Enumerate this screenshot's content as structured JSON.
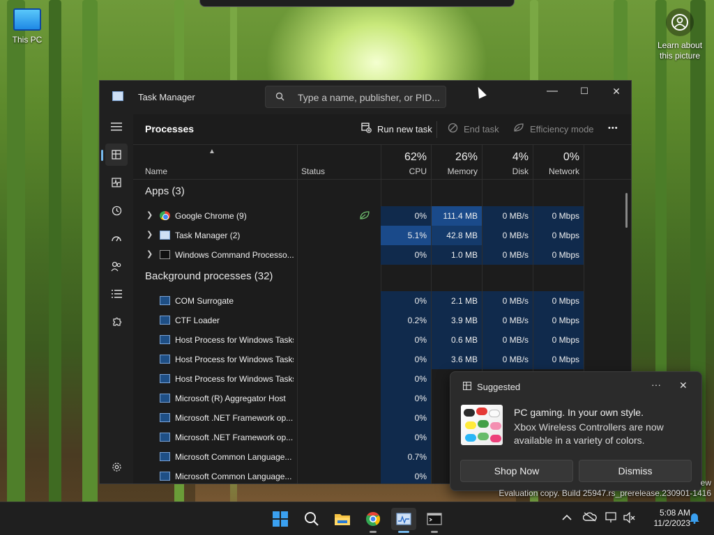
{
  "desktop": {
    "this_pc_label": "This PC",
    "learn_label_1": "Learn about",
    "learn_label_2": "this picture"
  },
  "window": {
    "title": "Task Manager",
    "search_placeholder": "Type a name, publisher, or PID...",
    "minimize": "—",
    "maximize": "☐",
    "close": "✕"
  },
  "toolbar": {
    "page_title": "Processes",
    "run_new_task": "Run new task",
    "end_task": "End task",
    "efficiency_mode": "Efficiency mode",
    "more": "•••"
  },
  "columns": {
    "name": "Name",
    "status": "Status",
    "cpu_pct": "62%",
    "cpu": "CPU",
    "memory_pct": "26%",
    "memory": "Memory",
    "disk_pct": "4%",
    "disk": "Disk",
    "network_pct": "0%",
    "network": "Network"
  },
  "groups": {
    "apps": "Apps (3)",
    "background": "Background processes (32)"
  },
  "apps": [
    {
      "name": "Google Chrome (9)",
      "cpu": "0%",
      "mem": "111.4 MB",
      "disk": "0 MB/s",
      "net": "0 Mbps"
    },
    {
      "name": "Task Manager (2)",
      "cpu": "5.1%",
      "mem": "42.8 MB",
      "disk": "0 MB/s",
      "net": "0 Mbps"
    },
    {
      "name": "Windows Command Processo...",
      "cpu": "0%",
      "mem": "1.0 MB",
      "disk": "0 MB/s",
      "net": "0 Mbps"
    }
  ],
  "background": [
    {
      "name": "COM Surrogate",
      "cpu": "0%",
      "mem": "2.1 MB",
      "disk": "0 MB/s",
      "net": "0 Mbps"
    },
    {
      "name": "CTF Loader",
      "cpu": "0.2%",
      "mem": "3.9 MB",
      "disk": "0 MB/s",
      "net": "0 Mbps"
    },
    {
      "name": "Host Process for Windows Tasks",
      "cpu": "0%",
      "mem": "0.6 MB",
      "disk": "0 MB/s",
      "net": "0 Mbps"
    },
    {
      "name": "Host Process for Windows Tasks",
      "cpu": "0%",
      "mem": "3.6 MB",
      "disk": "0 MB/s",
      "net": "0 Mbps"
    },
    {
      "name": "Host Process for Windows Tasks",
      "cpu": "0%"
    },
    {
      "name": "Microsoft (R) Aggregator Host",
      "cpu": "0%"
    },
    {
      "name": "Microsoft .NET Framework op...",
      "cpu": "0%"
    },
    {
      "name": "Microsoft .NET Framework op...",
      "cpu": "0%"
    },
    {
      "name": "Microsoft Common Language...",
      "cpu": "0.7%"
    },
    {
      "name": "Microsoft Common Language...",
      "cpu": "0%"
    }
  ],
  "popup": {
    "title": "Suggested",
    "more": "···",
    "close": "✕",
    "headline": "PC gaming. In your own style.",
    "body": "Xbox Wireless Controllers are now available in a variety of colors.",
    "shop_now": "Shop Now",
    "dismiss": "Dismiss"
  },
  "watermark": {
    "line1": "ew",
    "line2": "Evaluation copy. Build 25947.rs_prerelease.230901-1416"
  },
  "taskbar": {
    "time": "5:08 AM",
    "date": "11/2/2023"
  },
  "colors": {
    "accent": "#76b9ed",
    "heat_strong": "#1a4a8a",
    "heat_medium": "#143a6b",
    "heat_light": "#102a4c"
  }
}
